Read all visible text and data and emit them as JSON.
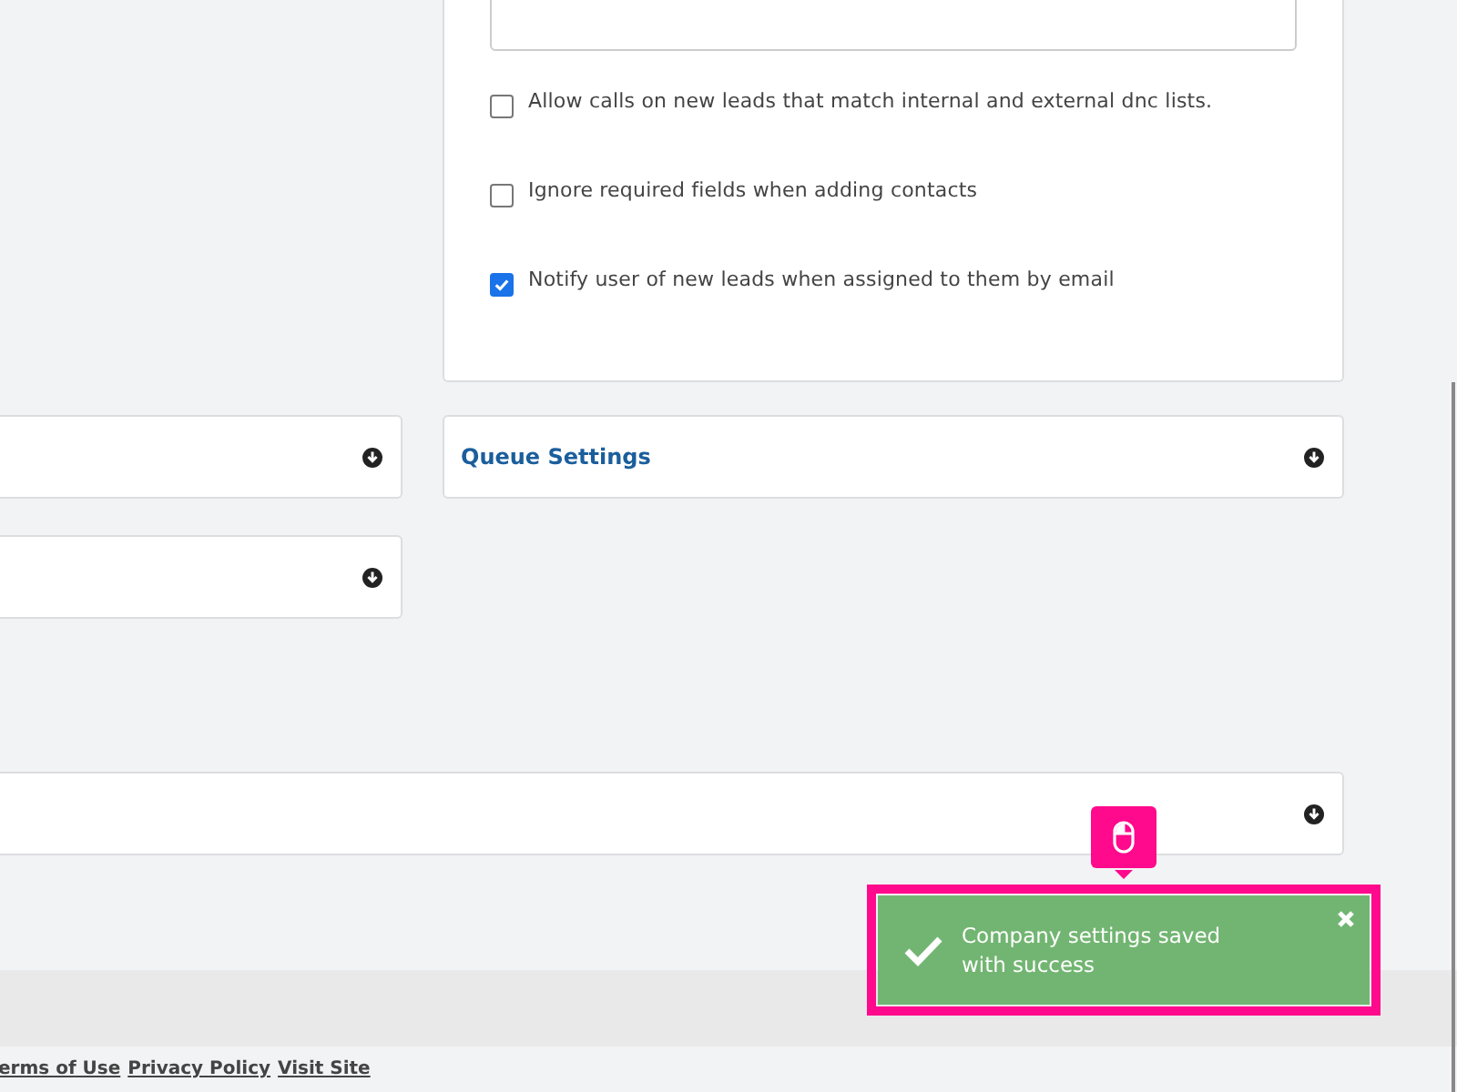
{
  "settings_card": {
    "options": [
      {
        "label": "Allow calls on new leads that match internal and external dnc lists.",
        "checked": false
      },
      {
        "label": "Ignore required fields when adding contacts",
        "checked": false
      },
      {
        "label": "Notify user of new leads when assigned to them by email",
        "checked": true
      }
    ]
  },
  "queue_panel": {
    "title": "Queue Settings"
  },
  "toast": {
    "message": "Company settings saved with success"
  },
  "footer": {
    "links": [
      "erms of Use",
      "Privacy Policy",
      "Visit Site"
    ]
  }
}
